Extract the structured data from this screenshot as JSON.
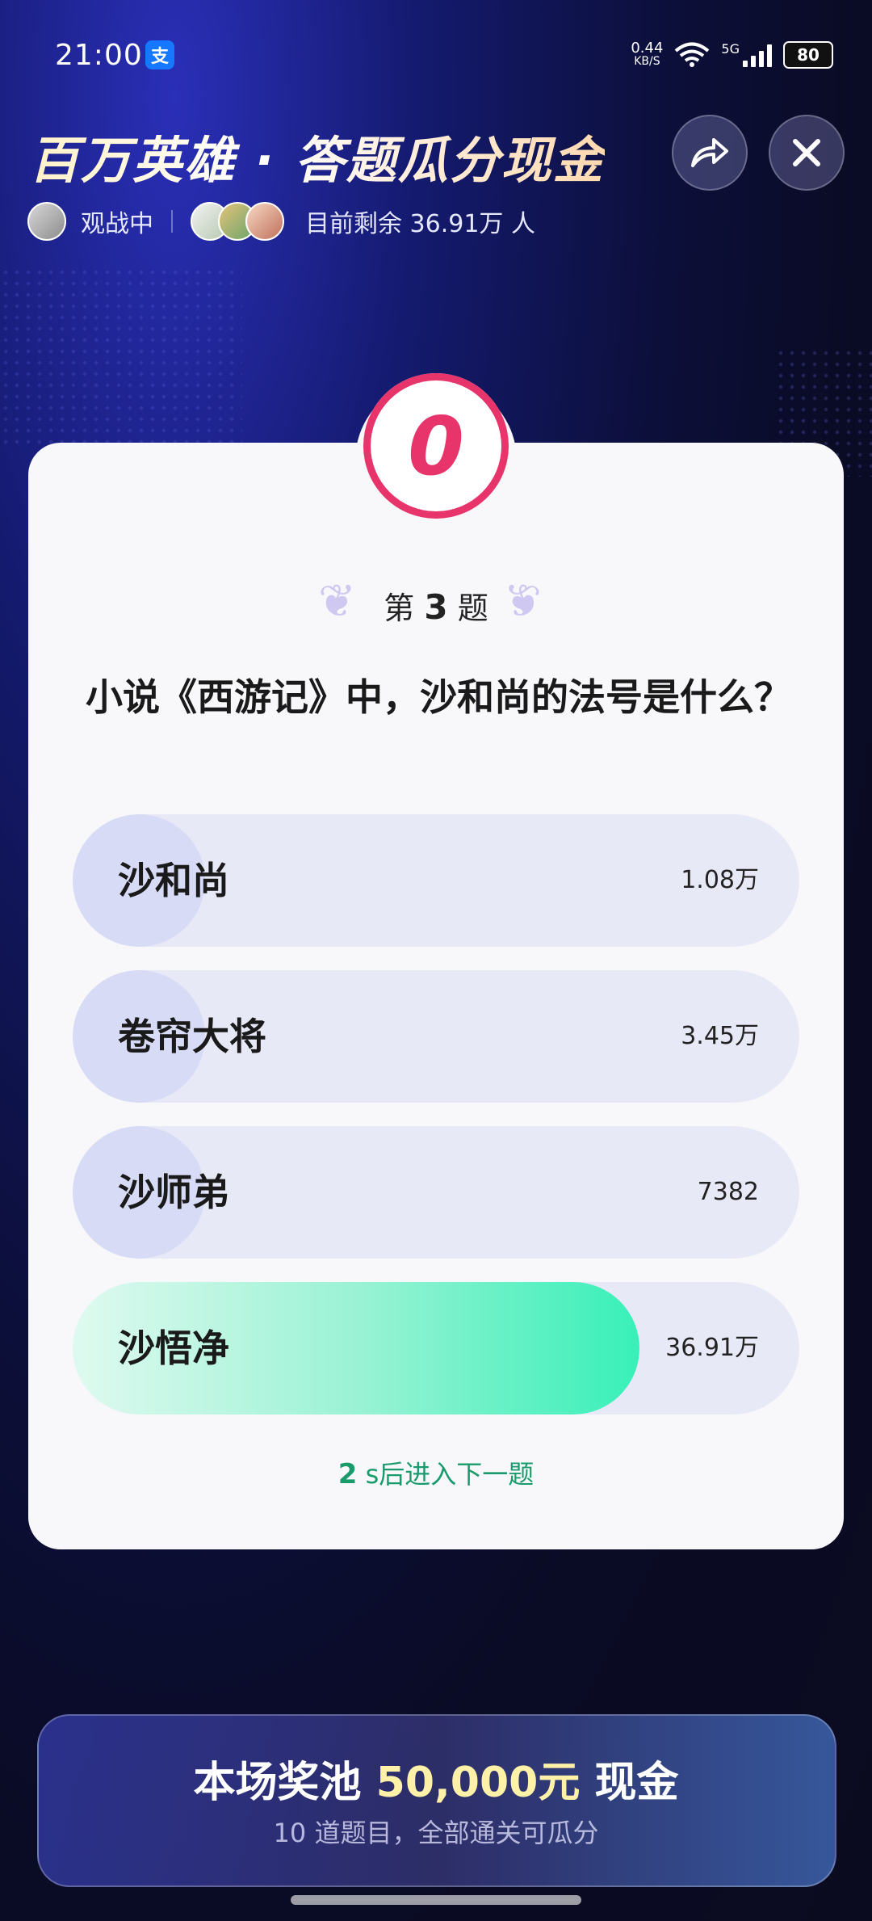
{
  "status_bar": {
    "time": "21:00",
    "app_icon": "支",
    "net_speed_value": "0.44",
    "net_speed_unit": "KB/S",
    "network": "5G",
    "battery": "80"
  },
  "header": {
    "title": "百万英雄 · 答题瓜分现金",
    "share_icon": "share-icon",
    "close_icon": "close-icon",
    "watching_label": "观战中",
    "remaining_label": "目前剩余 36.91万 人"
  },
  "quiz": {
    "timer_value": "0",
    "question_prefix": "第",
    "question_number": "3",
    "question_suffix": "题",
    "question_text": "小说《西游记》中，沙和尚的法号是什么？",
    "options": [
      {
        "label": "沙和尚",
        "count": "1.08万",
        "share": 0.02
      },
      {
        "label": "卷帘大将",
        "count": "3.45万",
        "share": 0.07
      },
      {
        "label": "沙师弟",
        "count": "7382",
        "share": 0.015
      },
      {
        "label": "沙悟净",
        "count": "36.91万",
        "share": 0.78,
        "correct": true
      }
    ],
    "next_seconds": "2",
    "next_hint": " s后进入下一题"
  },
  "pool": {
    "title_prefix": "本场奖池",
    "amount": "50,000元",
    "title_suffix": "现金",
    "subtitle": "10 道题目，全部通关可瓜分"
  },
  "colors": {
    "accent": "#e7346b",
    "correct": "#38f0b8",
    "hint": "#1a9b6c"
  }
}
